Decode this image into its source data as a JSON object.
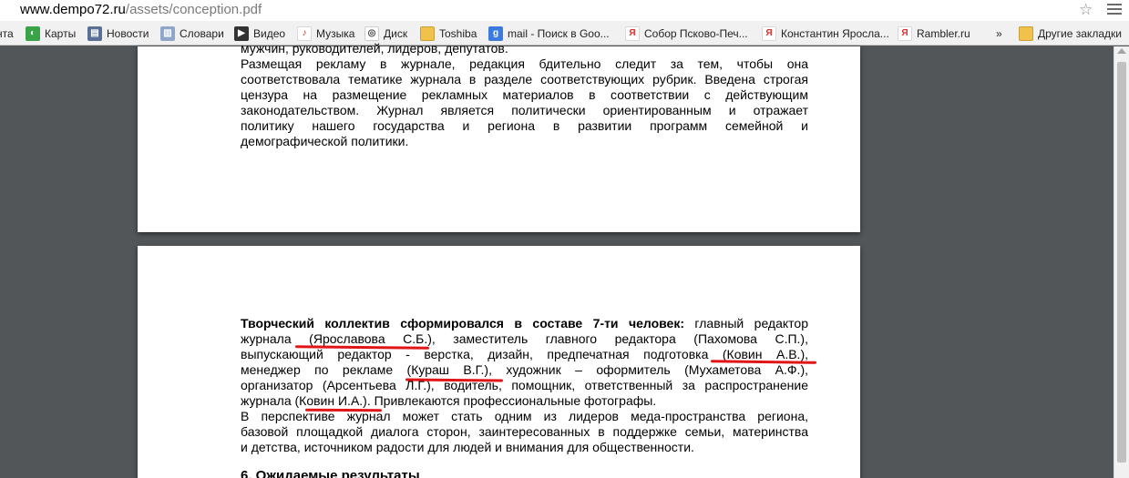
{
  "address": {
    "domain": "www.dempo72.ru",
    "path": "/assets/conception.pdf"
  },
  "bookmarks": [
    {
      "label": "нта",
      "icon": "none"
    },
    {
      "label": "Карты",
      "icon": "maps-icon"
    },
    {
      "label": "Новости",
      "icon": "news-icon"
    },
    {
      "label": "Словари",
      "icon": "dictionary-icon"
    },
    {
      "label": "Видео",
      "icon": "video-icon"
    },
    {
      "label": "Музыка",
      "icon": "music-icon"
    },
    {
      "label": "Диск",
      "icon": "disk-icon"
    },
    {
      "label": "Toshiba",
      "icon": "folder-icon"
    },
    {
      "label": "mail - Поиск в Goo...",
      "icon": "google-icon"
    },
    {
      "label": "Собор Псково-Печ...",
      "icon": "yandex-icon"
    },
    {
      "label": "Константин Яросла...",
      "icon": "yandex-icon"
    },
    {
      "label": "Rambler.ru",
      "icon": "yandex-icon"
    }
  ],
  "bookmarks_overflow": "»",
  "other_bookmarks": "Другие закладки",
  "page1": {
    "lines": [
      "мужчин, руководителей, лидеров, депутатов.",
      "Размещая рекламу в журнале, редакция бдительно следит за тем, чтобы она",
      "соответствовала тематике журнала в разделе соответствующих рубрик. Введена строгая",
      "цензура на размещение рекламных материалов в соответствии с действующим",
      "законодательством. Журнал является политически ориентированным и отражает",
      "политику нашего государства и региона в развитии программ семейной и",
      "демографической политики."
    ]
  },
  "page2": {
    "bold_lead": "Творческий коллектив сформировался в составе 7-ти человек:",
    "line1_rest": " главный редактор",
    "lines": [
      "журнала (Ярославова С.Б.), заместитель главного редактора (Пахомова С.П.),",
      "выпускающий редактор - верстка, дизайн, предпечатная подготовка (Ковин А.В.),",
      "менеджер по рекламе (Кураш В.Г.), художник – оформитель (Мухаметова А.Ф.),",
      "организатор (Арсентьева Л.Г.), водитель, помощник, ответственный за распространение",
      "журнала (Ковин И.А.). Привлекаются профессиональные фотографы.",
      "В перспективе журнал может стать одним из лидеров меда-пространства региона,",
      "базовой площадкой диалога сторон, заинтересованных в поддержке семьи, материнства",
      "и детства, источником радости для людей и внимания для общественности."
    ],
    "heading": "6. Ожидаемые результаты"
  }
}
